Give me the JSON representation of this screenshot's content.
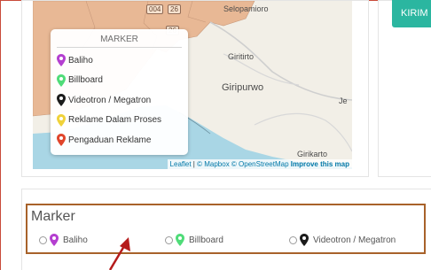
{
  "map": {
    "road_shields": [
      "004",
      "26",
      "26"
    ],
    "places": {
      "top": "Selopamioro",
      "giritirto": "Giritirto",
      "giripurwo": "Giripurwo",
      "je": "Je",
      "girikarto": "Girikarto"
    },
    "legend": {
      "title": "MARKER",
      "items": [
        {
          "label": "Baliho",
          "color": "#b43fd0"
        },
        {
          "label": "Billboard",
          "color": "#4fdc78"
        },
        {
          "label": "Videotron / Megatron",
          "color": "#1b1b1b"
        },
        {
          "label": "Reklame Dalam Proses",
          "color": "#f0d23a"
        },
        {
          "label": "Pengaduan Reklame",
          "color": "#e0452b"
        }
      ]
    },
    "attribution": {
      "leaflet": "Leaflet",
      "separator": " | ",
      "mapbox": "© Mapbox",
      "osm": "© OpenStreetMap",
      "improve": "Improve this map"
    }
  },
  "side": {
    "submit_label": "KIRIM"
  },
  "marker_filter": {
    "title": "Marker",
    "options": [
      {
        "label": "Baliho",
        "color": "#b43fd0"
      },
      {
        "label": "Billboard",
        "color": "#4fdc78"
      },
      {
        "label": "Videotron / Megatron",
        "color": "#1b1b1b"
      }
    ]
  },
  "colors": {
    "accent_button": "#2bb6a0",
    "highlight_box": "#a8622a",
    "annotation_arrow": "#b51b1b",
    "sea": "#a9d6e5",
    "land_region": "#e8b895"
  }
}
